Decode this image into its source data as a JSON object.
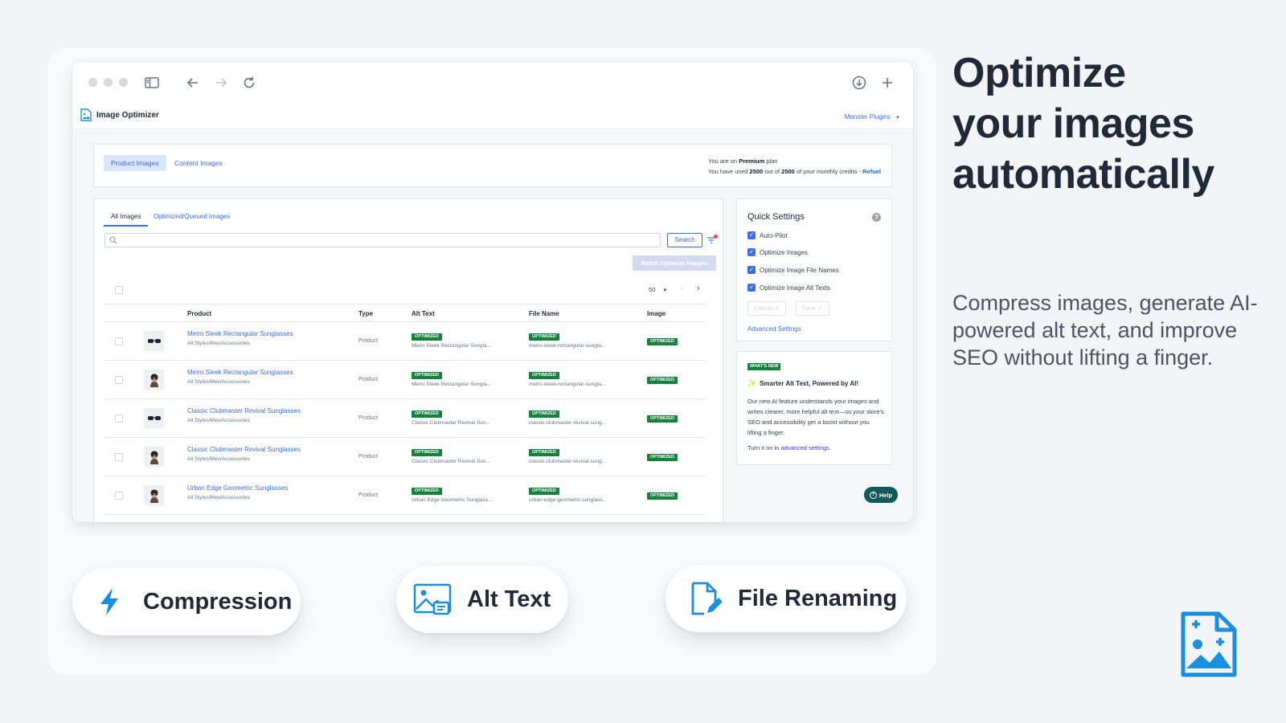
{
  "headline": [
    "Optimize",
    "your images",
    "automatically"
  ],
  "subline": "Compress images, generate AI-powered alt text, and improve SEO without lifting a finger.",
  "features": [
    {
      "label": "Compression",
      "icon": "lightning-icon"
    },
    {
      "label": "Alt Text",
      "icon": "image-text-icon"
    },
    {
      "label": "File Renaming",
      "icon": "file-edit-icon"
    }
  ],
  "browser": {
    "icons": [
      "sidebar-toggle-icon",
      "back-arrow-icon",
      "forward-arrow-icon",
      "reload-icon",
      "download-icon",
      "new-tab-icon"
    ]
  },
  "app": {
    "name": "Image Optimizer",
    "account": "Monster Plugins",
    "tabs": [
      "Product Images",
      "Content Images"
    ],
    "plan": {
      "prefix": "You are on",
      "plan_name": "Premium",
      "suffix": "plan",
      "usage_prefix": "You have used",
      "used": "2500",
      "usage_mid": "out of",
      "total": "2500",
      "usage_suffix": "of your monthly credits -",
      "refuel": "Refuel"
    },
    "subtabs": [
      "All Images",
      "Optimized/Queued Images"
    ],
    "search_label": "Search",
    "batch_label": "Batch Optimize Images",
    "per_page": "50",
    "columns": {
      "product": "Product",
      "type": "Type",
      "alt_text": "Alt Text",
      "file_name": "File Name",
      "image": "Image"
    },
    "badge": "OPTIMIZED",
    "rows": [
      {
        "name": "Metro Sleek Rectangular Sunglasses",
        "category": "All Styles/Men/Accessories",
        "type": "Product",
        "alt": "Metro Sleek Rectangular Sungla...",
        "file": "metro-sleek-rectangular-sungla...",
        "thumb": "sunglasses-icon"
      },
      {
        "name": "Metro Sleek Rectangular Sunglasses",
        "category": "All Styles/Men/Accessories",
        "type": "Product",
        "alt": "Metro Sleek Rectangular Sungla...",
        "file": "metro-sleek-rectangular-sungla...",
        "thumb": "person-sunglasses-icon"
      },
      {
        "name": "Classic Clubmaster Revival Sunglasses",
        "category": "All Styles/Men/Accessories",
        "type": "Product",
        "alt": "Classic Clubmaster Revival Sun...",
        "file": "classic-clubmaster-revival-sung...",
        "thumb": "sunglasses-icon"
      },
      {
        "name": "Classic Clubmaster Revival Sunglasses",
        "category": "All Styles/Men/Accessories",
        "type": "Product",
        "alt": "Classic Clubmaster Revival Sun...",
        "file": "classic-clubmaster-revival-sung...",
        "thumb": "person-sunglasses-icon"
      },
      {
        "name": "Urban Edge Geometric Sunglasses",
        "category": "All Styles/Men/Accessories",
        "type": "Product",
        "alt": "Urban Edge Geometric Sunglass...",
        "file": "urban-edge-geometric-sunglass...",
        "thumb": "person-sunglasses-icon"
      }
    ],
    "quick_settings": {
      "title": "Quick Settings",
      "help": "?",
      "items": [
        "Auto-Pilot",
        "Optimize Images",
        "Optimize Image File Names",
        "Optimize Image Alt Texts"
      ],
      "cancel": "Cancel",
      "save": "Save",
      "advanced": "Advanced Settings"
    },
    "whats_new": {
      "badge": "WHAT'S NEW",
      "title": "Smarter Alt Text, Powered by AI!",
      "body": "Our new AI feature understands your images and writes clearer, more helpful alt text—so your store's SEO and accessibility get a boost without you lifting a finger.",
      "cta_prefix": "Turn it on in",
      "cta_link": "advanced settings."
    },
    "help_label": "Help"
  },
  "colors": {
    "accent": "#3b6ee0",
    "badge": "#16803c",
    "help": "#0f5b5b",
    "brand_icon": "#1a8fe0"
  }
}
